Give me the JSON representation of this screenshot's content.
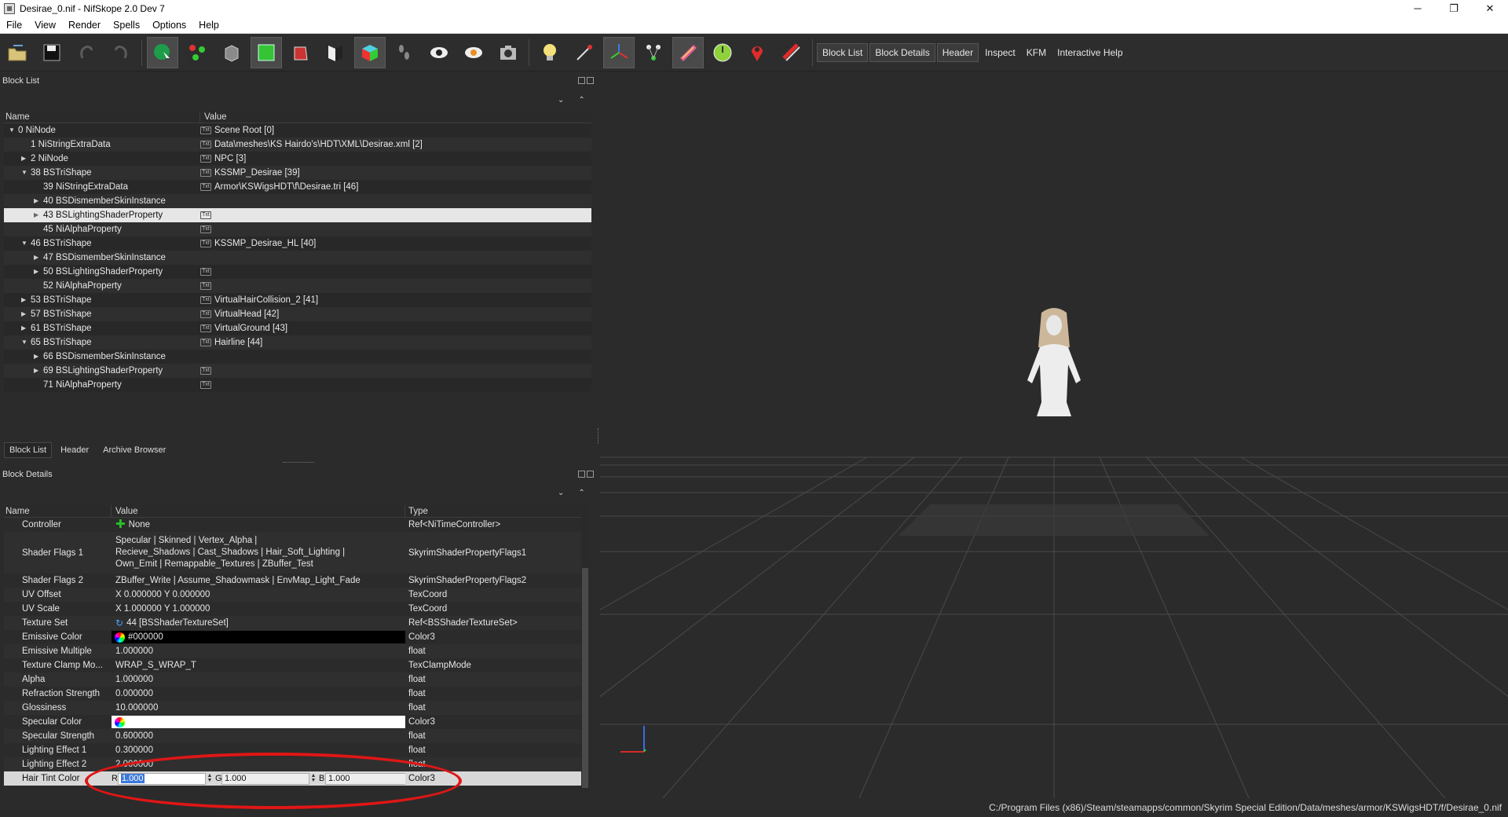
{
  "window": {
    "title": "Desirae_0.nif - NifSkope 2.0 Dev 7",
    "controls": [
      "─",
      "❐",
      "✕"
    ]
  },
  "menu": [
    "File",
    "View",
    "Render",
    "Spells",
    "Options",
    "Help"
  ],
  "toolbar": {
    "text_buttons": [
      "Block List",
      "Block Details",
      "Header",
      "Inspect",
      "KFM",
      "Interactive Help"
    ]
  },
  "block_list": {
    "title": "Block List",
    "col_name": "Name",
    "col_value": "Value",
    "rows": [
      {
        "name": "0 NiNode",
        "value": "Scene Root [0]",
        "indent": 0,
        "arrow": "down",
        "txt": true
      },
      {
        "name": "1 NiStringExtraData",
        "value": "Data\\meshes\\KS Hairdo's\\HDT\\XML\\Desirae.xml [2]",
        "indent": 1,
        "arrow": "",
        "txt": true
      },
      {
        "name": "2 NiNode",
        "value": "NPC [3]",
        "indent": 1,
        "arrow": "right",
        "txt": true
      },
      {
        "name": "38 BSTriShape",
        "value": "KSSMP_Desirae [39]",
        "indent": 1,
        "arrow": "down",
        "txt": true
      },
      {
        "name": "39 NiStringExtraData",
        "value": "Armor\\KSWigsHDT\\f\\Desirae.tri [46]",
        "indent": 2,
        "arrow": "",
        "txt": true
      },
      {
        "name": "40 BSDismemberSkinInstance",
        "value": "",
        "indent": 2,
        "arrow": "right",
        "txt": false
      },
      {
        "name": "43 BSLightingShaderProperty",
        "value": "",
        "indent": 2,
        "arrow": "right",
        "txt": true,
        "selected": true
      },
      {
        "name": "45 NiAlphaProperty",
        "value": "",
        "indent": 2,
        "arrow": "",
        "txt": true
      },
      {
        "name": "46 BSTriShape",
        "value": "KSSMP_Desirae_HL [40]",
        "indent": 1,
        "arrow": "down",
        "txt": true
      },
      {
        "name": "47 BSDismemberSkinInstance",
        "value": "",
        "indent": 2,
        "arrow": "right",
        "txt": false
      },
      {
        "name": "50 BSLightingShaderProperty",
        "value": "",
        "indent": 2,
        "arrow": "right",
        "txt": true
      },
      {
        "name": "52 NiAlphaProperty",
        "value": "",
        "indent": 2,
        "arrow": "",
        "txt": true
      },
      {
        "name": "53 BSTriShape",
        "value": "VirtualHairCollision_2 [41]",
        "indent": 1,
        "arrow": "right",
        "txt": true
      },
      {
        "name": "57 BSTriShape",
        "value": "VirtualHead [42]",
        "indent": 1,
        "arrow": "right",
        "txt": true
      },
      {
        "name": "61 BSTriShape",
        "value": "VirtualGround [43]",
        "indent": 1,
        "arrow": "right",
        "txt": true
      },
      {
        "name": "65 BSTriShape",
        "value": "Hairline [44]",
        "indent": 1,
        "arrow": "down",
        "txt": true
      },
      {
        "name": "66 BSDismemberSkinInstance",
        "value": "",
        "indent": 2,
        "arrow": "right",
        "txt": false
      },
      {
        "name": "69 BSLightingShaderProperty",
        "value": "",
        "indent": 2,
        "arrow": "right",
        "txt": true
      },
      {
        "name": "71 NiAlphaProperty",
        "value": "",
        "indent": 2,
        "arrow": "",
        "txt": true
      }
    ],
    "txt_glyph": "Txt"
  },
  "bottom_tabs": [
    "Block List",
    "Header",
    "Archive Browser"
  ],
  "block_details": {
    "title": "Block Details",
    "col_name": "Name",
    "col_value": "Value",
    "col_type": "Type",
    "rows": [
      {
        "name": "Controller",
        "value": "None",
        "type": "Ref<NiTimeController>",
        "icon": "plus"
      },
      {
        "name": "Shader Flags 1",
        "value_lines": [
          "Specular | Skinned | Vertex_Alpha |",
          "Recieve_Shadows | Cast_Shadows | Hair_Soft_Lighting |",
          "Own_Emit | Remappable_Textures | ZBuffer_Test"
        ],
        "type": "SkyrimShaderPropertyFlags1"
      },
      {
        "name": "Shader Flags 2",
        "value": "ZBuffer_Write | Assume_Shadowmask | EnvMap_Light_Fade",
        "type": "SkyrimShaderPropertyFlags2"
      },
      {
        "name": "UV Offset",
        "value": "X 0.000000 Y 0.000000",
        "type": "TexCoord"
      },
      {
        "name": "UV Scale",
        "value": "X 1.000000 Y 1.000000",
        "type": "TexCoord"
      },
      {
        "name": "Texture Set",
        "value": "44 [BSShaderTextureSet]",
        "type": "Ref<BSShaderTextureSet>",
        "icon": "link"
      },
      {
        "name": "Emissive Color",
        "value": "#000000",
        "type": "Color3",
        "icon": "color-black"
      },
      {
        "name": "Emissive Multiple",
        "value": "1.000000",
        "type": "float"
      },
      {
        "name": "Texture Clamp Mo...",
        "value": "WRAP_S_WRAP_T",
        "type": "TexClampMode"
      },
      {
        "name": "Alpha",
        "value": "1.000000",
        "type": "float"
      },
      {
        "name": "Refraction Strength",
        "value": "0.000000",
        "type": "float"
      },
      {
        "name": "Glossiness",
        "value": "10.000000",
        "type": "float"
      },
      {
        "name": "Specular Color",
        "value": "",
        "type": "Color3",
        "icon": "color-white"
      },
      {
        "name": "Specular Strength",
        "value": "0.600000",
        "type": "float"
      },
      {
        "name": "Lighting Effect 1",
        "value": "0.300000",
        "type": "float"
      },
      {
        "name": "Lighting Effect 2",
        "value": "2.000000",
        "type": "float"
      }
    ],
    "edit_row": {
      "name": "Hair Tint Color",
      "r_label": "R",
      "r_value": "1.000",
      "g_label": "G",
      "g_value": "1.000",
      "b_label": "B",
      "b_value": "1.000",
      "type": "Color3"
    }
  },
  "status": {
    "path": "C:/Program Files (x86)/Steam/steamapps/common/Skyrim Special Edition/Data/meshes/armor/KSWigsHDT/f/Desirae_0.nif"
  },
  "colors": {
    "background": "#2b2b2b",
    "selection": "#e6e6e6",
    "annotation": "#e01616"
  }
}
